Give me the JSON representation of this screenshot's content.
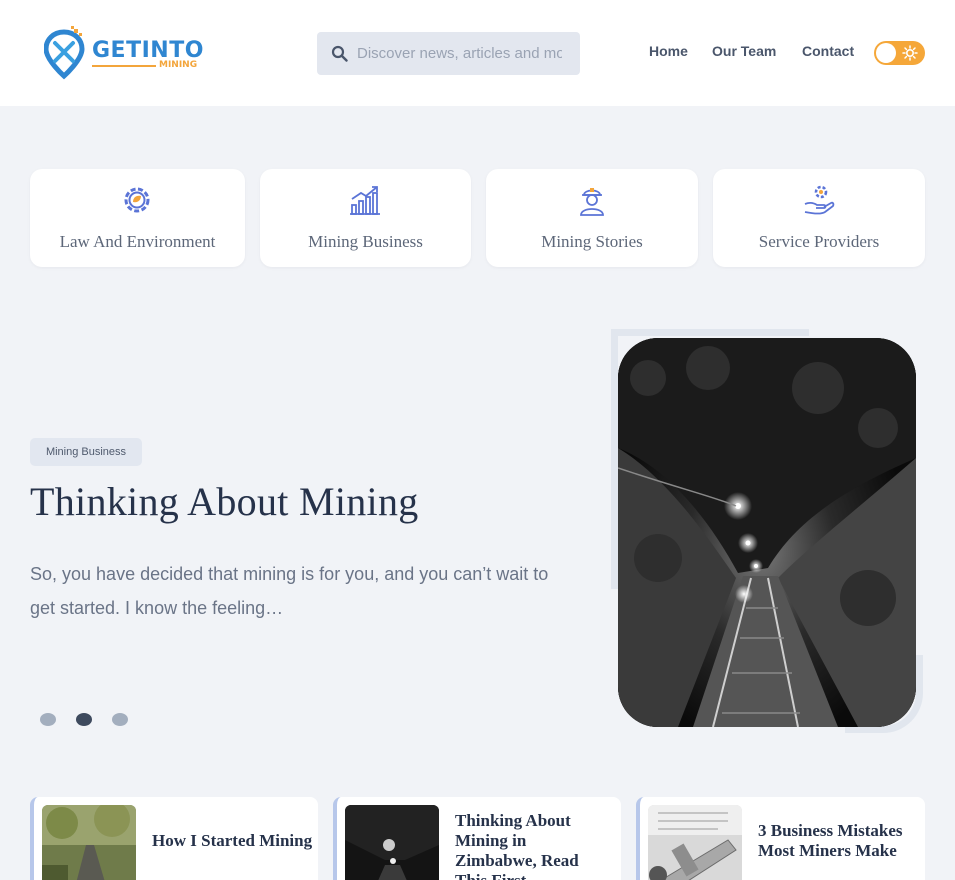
{
  "header": {
    "logo_text": "GETINTO",
    "logo_sub": "MINING",
    "search_placeholder": "Discover news, articles and more",
    "nav": [
      "Home",
      "Our Team",
      "Contact"
    ]
  },
  "categories": [
    {
      "label": "Law And Environment",
      "icon": "gear-leaf-icon"
    },
    {
      "label": "Mining Business",
      "icon": "growth-chart-icon"
    },
    {
      "label": "Mining Stories",
      "icon": "miner-icon"
    },
    {
      "label": "Service Providers",
      "icon": "gear-hand-icon"
    }
  ],
  "hero": {
    "badge": "Mining Business",
    "title": "Thinking About Mining",
    "text": "So, you have decided that mining is for you, and you can’t wait to get started. I know the feeling…",
    "slides": 3,
    "active_slide": 2
  },
  "posts": [
    {
      "title": "How I Started Mining"
    },
    {
      "title": "Thinking About Mining in Zimbabwe, Read This First"
    },
    {
      "title": "3 Business Mistakes Most Miners Make"
    }
  ],
  "colors": {
    "accent": "#5b74d6",
    "logo_blue": "#2f86d1",
    "logo_orange": "#f3a53b",
    "toggle": "#f5a739"
  }
}
